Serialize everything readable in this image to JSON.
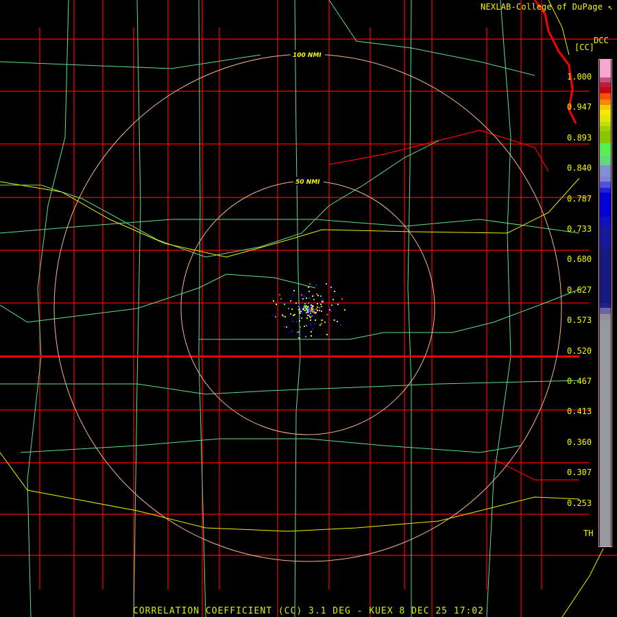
{
  "header": {
    "credit": "NEXLAB-College of DuPage ↖",
    "product_code": "DCC",
    "unit": "[CC]"
  },
  "range_rings": [
    {
      "label": "50 NMI"
    },
    {
      "label": "100 NMI"
    }
  ],
  "legend": {
    "labels": [
      "1.000",
      "0.947",
      "0.893",
      "0.840",
      "0.787",
      "0.733",
      "0.680",
      "0.627",
      "0.573",
      "0.520",
      "0.467",
      "0.413",
      "0.360",
      "0.307",
      "0.253",
      "TH"
    ],
    "colors": [
      "#f8a8d0",
      "#c85080",
      "#b82040",
      "#c80810",
      "#f85000",
      "#f88800",
      "#f8c800",
      "#f8e800",
      "#e0e800",
      "#c0e000",
      "#a0d000",
      "#88c800",
      "#58f050",
      "#60d880",
      "#8090d0",
      "#8080d8",
      "#5050d8",
      "#2020d8",
      "#0000d8",
      "#1010c0",
      "#18189a",
      "#181880",
      "#202088",
      "#6868a0",
      "#909098",
      "#9898a0"
    ]
  },
  "colors": {
    "county_lines": "#f80000",
    "roads": "#60e090",
    "interstates": "#f8f800",
    "rings": "#f8b890"
  },
  "caption": "CORRELATION COEFFICIENT (CC) 3.1 DEG - KUEX 8 DEC 25 17:02"
}
